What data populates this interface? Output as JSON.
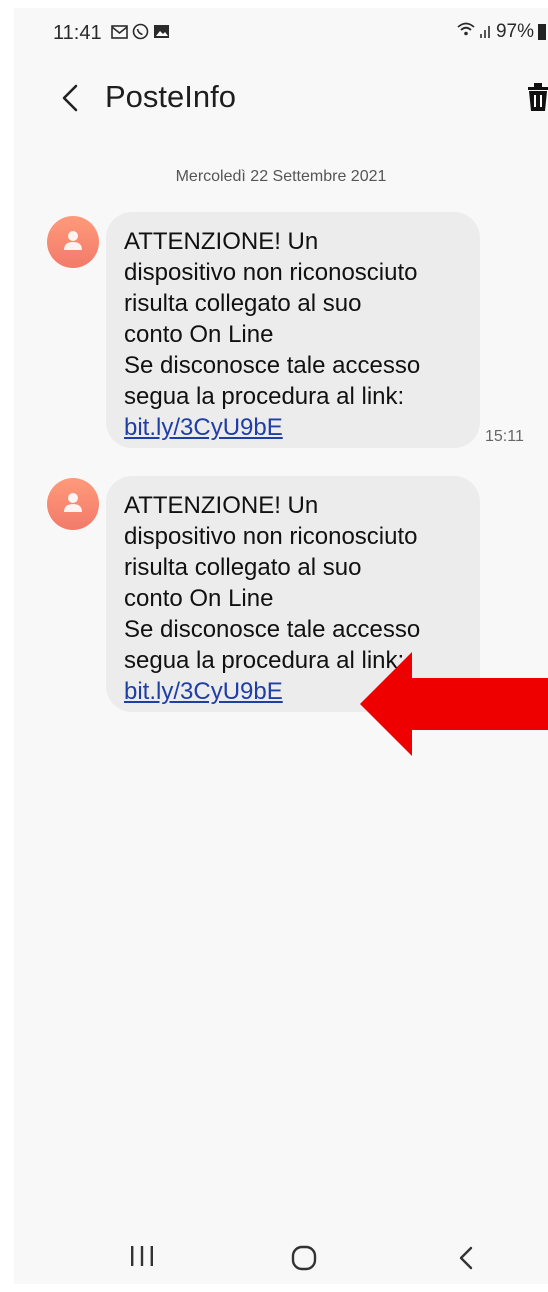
{
  "status_bar": {
    "time": "11:41",
    "notification_icons": [
      "gmail-icon",
      "whatsapp-icon",
      "gallery-icon"
    ],
    "battery": "97%"
  },
  "header": {
    "title": "PosteInfo"
  },
  "conversation": {
    "date": "Mercoledì 22 Settembre 2021",
    "messages": [
      {
        "lines": [
          "ATTENZIONE! Un",
          "dispositivo non riconosciuto",
          "risulta collegato al suo",
          "conto On Line",
          "Se disconosce tale accesso",
          "segua la procedura al link:"
        ],
        "link": "bit.ly/3CyU9bE",
        "time": "15:11"
      },
      {
        "lines": [
          "ATTENZIONE! Un",
          "dispositivo non riconosciuto",
          "risulta collegato al suo",
          "conto On Line",
          "Se disconosce tale accesso",
          "segua la procedura al link:"
        ],
        "link": "bit.ly/3CyU9bE"
      }
    ]
  },
  "colors": {
    "link": "#1f3ea8",
    "bubble": "#ececec",
    "avatar": "#f58b74",
    "annotation_arrow": "#ee0000"
  }
}
